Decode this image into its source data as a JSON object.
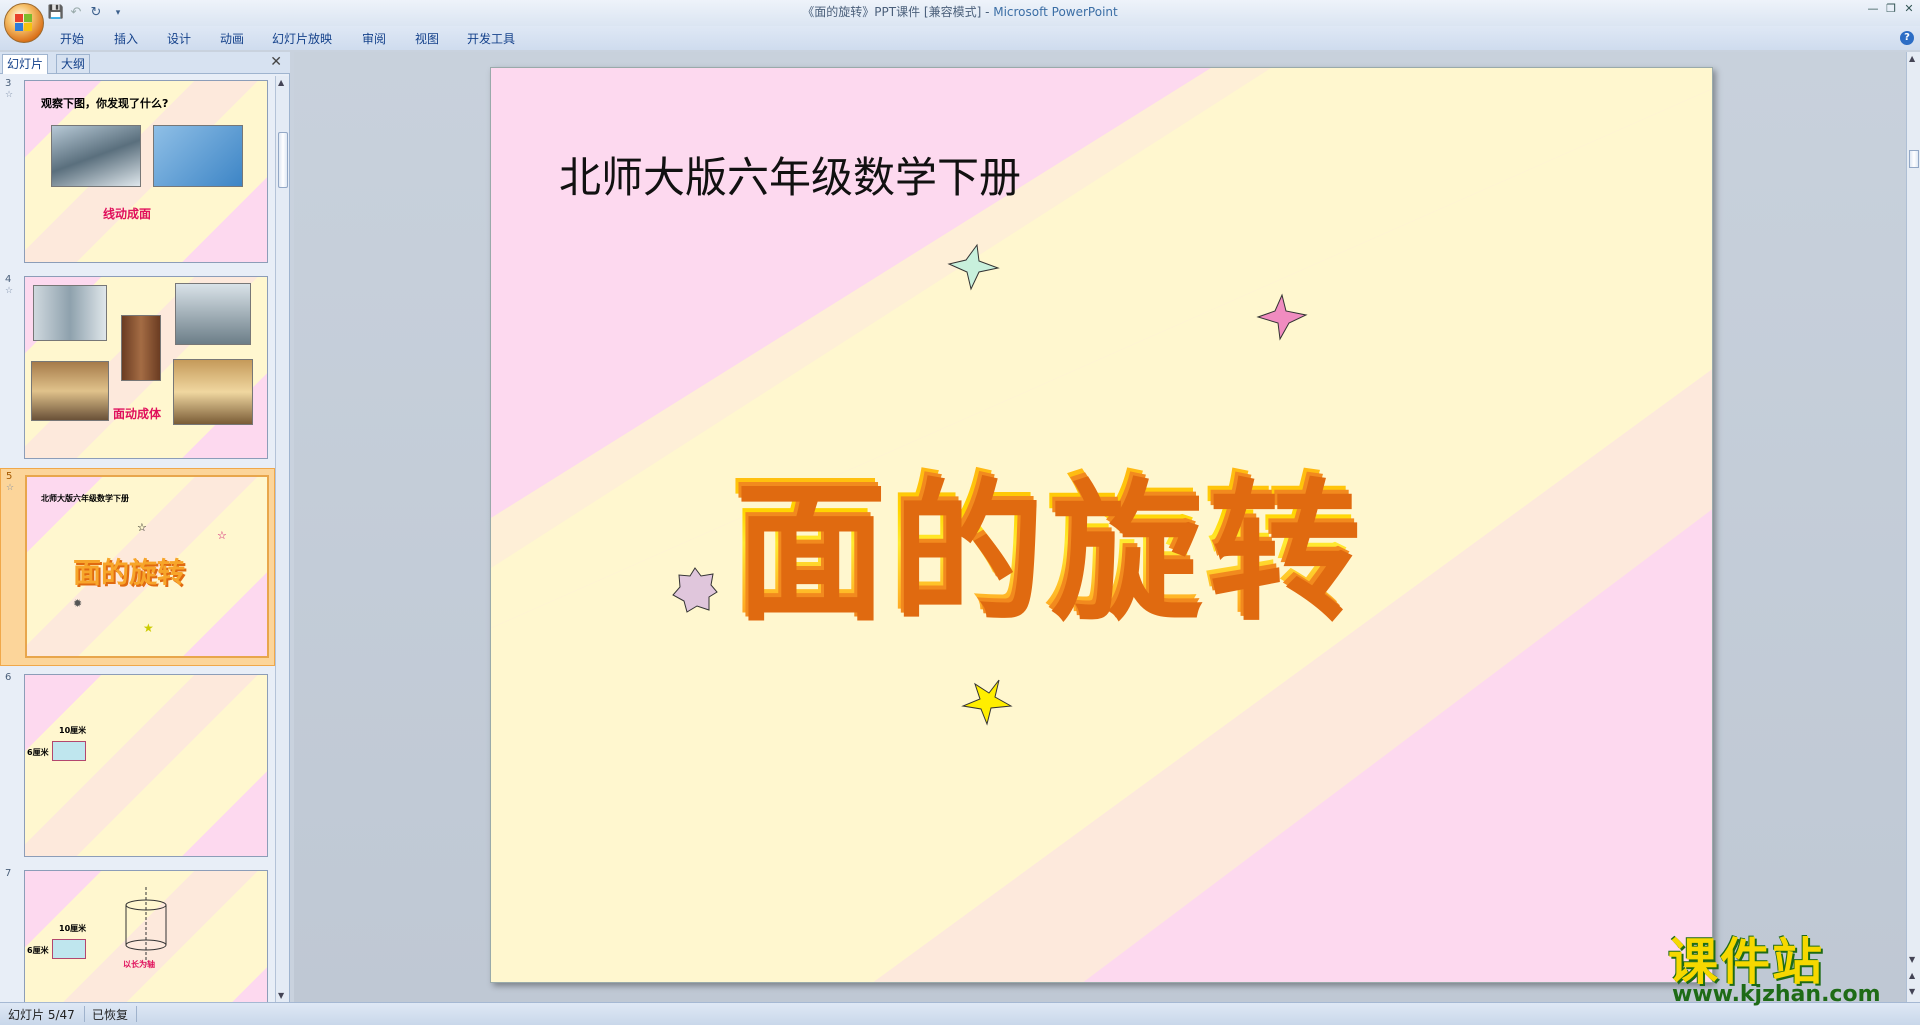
{
  "window": {
    "title": "《面的旋转》PPT课件 [兼容模式]",
    "app_name": "Microsoft PowerPoint",
    "title_sep": " - "
  },
  "ribbon": {
    "tabs": [
      "开始",
      "插入",
      "设计",
      "动画",
      "幻灯片放映",
      "审阅",
      "视图",
      "开发工具"
    ]
  },
  "left_panel": {
    "tabs": [
      "幻灯片",
      "大纲"
    ],
    "active_tab": "幻灯片",
    "thumbnails": [
      {
        "num": "3",
        "title": "观察下图，你发现了什么?",
        "caption": "线动成面"
      },
      {
        "num": "4",
        "caption": "面动成体"
      },
      {
        "num": "5",
        "title": "北师大版六年级数学下册",
        "big": "面的旋转",
        "selected": true
      },
      {
        "num": "6",
        "label_top": "10厘米",
        "label_left": "6厘米"
      },
      {
        "num": "7",
        "label_top": "10厘米",
        "label_left": "6厘米",
        "caption": "以长为轴"
      }
    ]
  },
  "slide": {
    "subtitle": "北师大版六年级数学下册",
    "title": "面的旋转",
    "colors": {
      "pink": "#fdd9ef",
      "cream": "#fff7cf",
      "peach": "#fde9dc",
      "title_orange": "#f5a020",
      "title_yellow": "#ffd400"
    },
    "stars": [
      {
        "name": "mint-star",
        "color": "#c8f0dc"
      },
      {
        "name": "pink-star",
        "color": "#f08cc0"
      },
      {
        "name": "lilac-star",
        "color": "#e0c6dc"
      },
      {
        "name": "yellow-star",
        "color": "#ffee00"
      }
    ]
  },
  "status": {
    "slide_info": "幻灯片 5/47",
    "state": "已恢复"
  },
  "watermark": {
    "cn": "课件站",
    "url": "www.kjzhan.com"
  }
}
